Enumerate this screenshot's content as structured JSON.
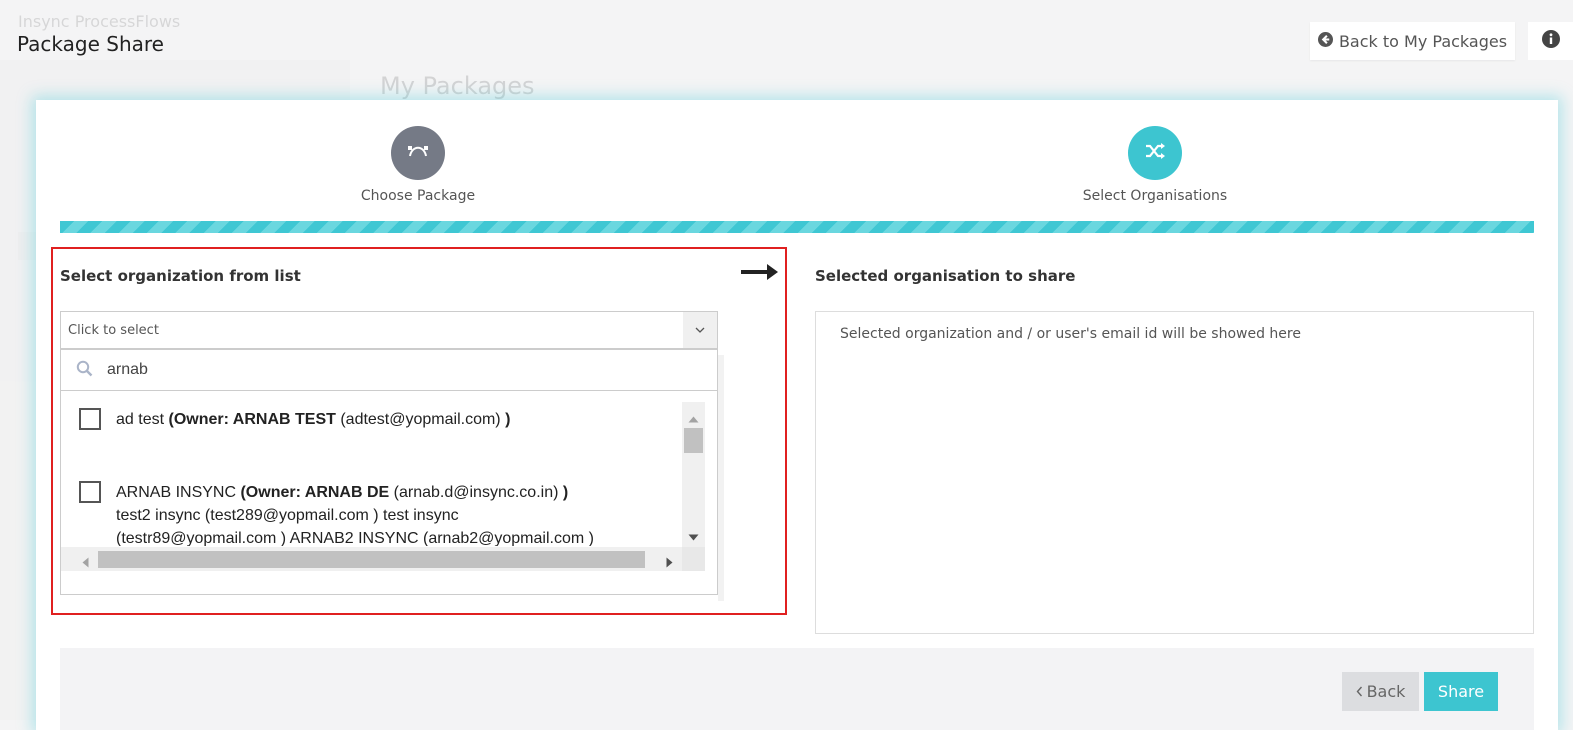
{
  "page": {
    "title": "Package Share",
    "back_to_packages": "Back to My Packages"
  },
  "background": {
    "app_name": "Insync ProcessFlows",
    "heading": "My Packages"
  },
  "wizard": {
    "steps": [
      {
        "label": "Choose Package",
        "icon": "curve-icon",
        "color": "#757a86"
      },
      {
        "label": "Select Organisations",
        "icon": "shuffle-icon",
        "color": "#3dc5d0"
      }
    ],
    "progress_percent": 100
  },
  "left_panel": {
    "title": "Select organization from list",
    "select_placeholder": "Click to select",
    "search_value": "arnab",
    "options": [
      {
        "checked": false,
        "name": "ad test ",
        "owner_label": "(Owner: ARNAB TEST",
        "owner_email": " (adtest@yopmail.com) ",
        "close": ")",
        "extra_lines": []
      },
      {
        "checked": false,
        "name": "ARNAB INSYNC ",
        "owner_label": "(Owner: ARNAB DE",
        "owner_email": " (arnab.d@insync.co.in) ",
        "close": ")",
        "extra_lines": [
          "test2 insync (test289@yopmail.com ) test insync",
          "(testr89@yopmail.com ) ARNAB2 INSYNC (arnab2@yopmail.com )"
        ]
      }
    ]
  },
  "right_panel": {
    "title": "Selected organisation to share",
    "placeholder": "Selected organization and / or user's email id will be showed here"
  },
  "footer": {
    "back_label": "Back",
    "share_label": "Share"
  },
  "colors": {
    "accent": "#3dc5d0",
    "highlight_frame": "#e02020",
    "step_inactive": "#757a86"
  }
}
